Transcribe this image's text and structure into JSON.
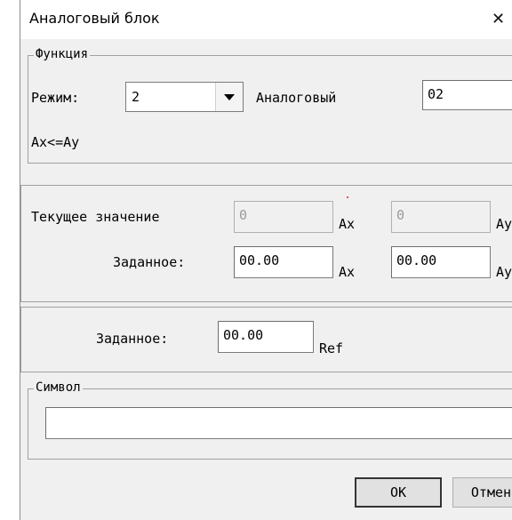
{
  "window": {
    "title": "Аналоговый блок",
    "close_glyph": "✕"
  },
  "function_group": {
    "legend": "Функция",
    "mode_label": "Режим:",
    "mode_value": "2",
    "analog_label": "Аналоговый",
    "analog_value": "02",
    "condition": "Ax<=Ay"
  },
  "values": {
    "current_label": "Текущее значение",
    "current_ax": "0",
    "current_ay": "0",
    "setpoint_label": "Заданное:",
    "setpoint_ax": "00.00",
    "setpoint_ay": "00.00",
    "ax_unit": "Ax",
    "ay_unit": "Ay"
  },
  "ref": {
    "label": "Заданное:",
    "value": "00.00",
    "unit": "Ref"
  },
  "symbol_group": {
    "legend": "Символ",
    "value": ""
  },
  "buttons": {
    "ok": "OK",
    "cancel": "Отмена"
  },
  "colors": {
    "dialog_bg": "#f0f0f0",
    "marker": "#e02020"
  }
}
